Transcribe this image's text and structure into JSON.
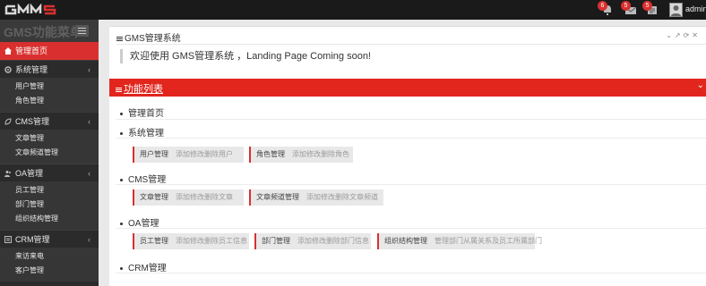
{
  "app": {
    "logo_text": "GMS",
    "notifications": [
      {
        "icon": "bell-icon",
        "count": "6"
      },
      {
        "icon": "envelope-icon",
        "count": "5"
      },
      {
        "icon": "task-icon",
        "count": "5"
      }
    ],
    "user": "admin"
  },
  "sidebar": {
    "title": "GMS功能菜单",
    "items": [
      {
        "label": "管理首页",
        "active": true
      },
      {
        "label": "系统管理",
        "children": [
          "用户管理",
          "角色管理"
        ]
      },
      {
        "label": "CMS管理",
        "children": [
          "文章管理",
          "文章频道管理"
        ]
      },
      {
        "label": "OA管理",
        "children": [
          "员工管理",
          "部门管理",
          "组织结构管理"
        ]
      },
      {
        "label": "CRM管理",
        "children": [
          "来访来电",
          "客户管理"
        ]
      }
    ]
  },
  "welcome_panel": {
    "title": "GMS管理系统",
    "message": "欢迎使用 GMS管理系统 ，Landing Page Coming soon!"
  },
  "function_panel": {
    "title": "功能列表",
    "sections": [
      {
        "title": "管理首页",
        "cards": []
      },
      {
        "title": "系统管理",
        "cards": [
          {
            "name": "用户管理",
            "desc": "添加修改删除用户"
          },
          {
            "name": "角色管理",
            "desc": "添加修改删除角色"
          }
        ]
      },
      {
        "title": "CMS管理",
        "cards": [
          {
            "name": "文章管理",
            "desc": "添加修改删除文章"
          },
          {
            "name": "文章频道管理",
            "desc": "添加修改删除文章频道"
          }
        ]
      },
      {
        "title": "OA管理",
        "cards": [
          {
            "name": "员工管理",
            "desc": "添加修改删除员工信息"
          },
          {
            "name": "部门管理",
            "desc": "添加修改删除部门信息"
          },
          {
            "name": "组织结构管理",
            "desc": "管理部门从属关系及员工所属部门"
          }
        ]
      },
      {
        "title": "CRM管理",
        "cards": []
      }
    ]
  },
  "colors": {
    "accent": "#d9302f",
    "topbar": "#1a1a1a",
    "sidebar": "#2b2b2b"
  }
}
